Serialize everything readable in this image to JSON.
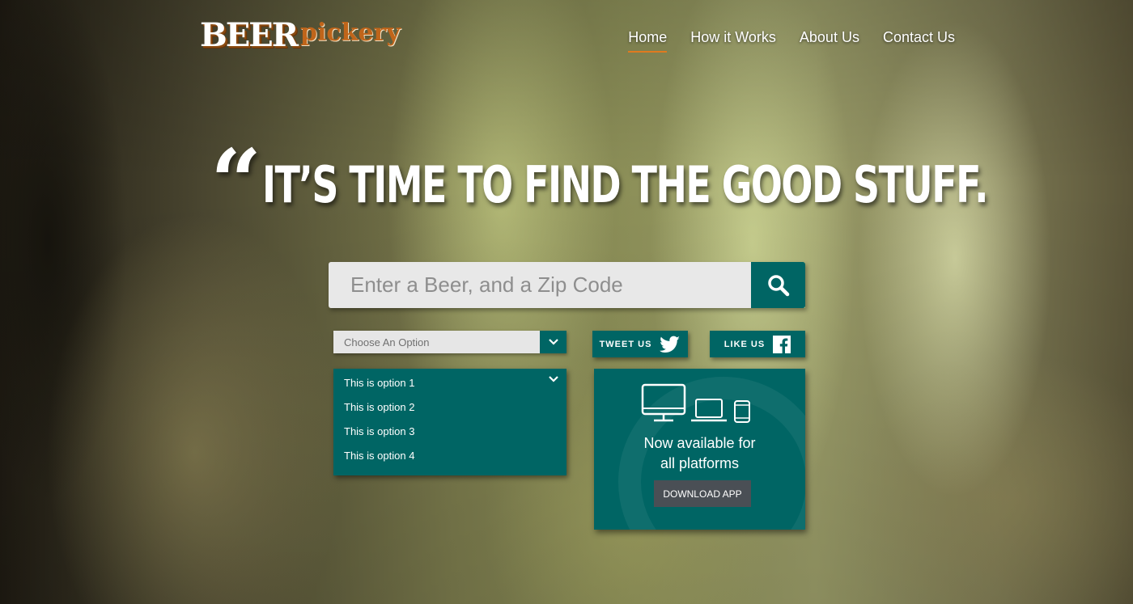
{
  "brand": {
    "logo_word_1": "BEER",
    "logo_word_2": "pickery",
    "accent_color": "#e07a1f",
    "primary_color": "#006564"
  },
  "nav": {
    "items": [
      {
        "label": "Home",
        "active": true
      },
      {
        "label": "How it Works",
        "active": false
      },
      {
        "label": "About Us",
        "active": false
      },
      {
        "label": "Contact Us",
        "active": false
      }
    ]
  },
  "hero": {
    "quote_mark": "“",
    "headline": "IT’S TIME TO FIND THE GOOD STUFF."
  },
  "search": {
    "placeholder": "Enter a Beer, and a Zip Code",
    "value": "",
    "icon": "search-icon"
  },
  "select": {
    "placeholder": "Choose An Option",
    "options": [
      "This is option 1",
      "This is option 2",
      "This is option 3",
      "This is option 4"
    ],
    "icon": "chevron-down-icon"
  },
  "social": {
    "tweet_label": "TWEET US",
    "tweet_icon": "twitter-bird-icon",
    "like_label": "LIKE US",
    "like_icon": "facebook-icon"
  },
  "promo": {
    "line1": "Now available for",
    "line2": "all platforms",
    "download_label": "DOWNLOAD APP",
    "icons": [
      "desktop-icon",
      "laptop-icon",
      "phone-icon"
    ]
  }
}
